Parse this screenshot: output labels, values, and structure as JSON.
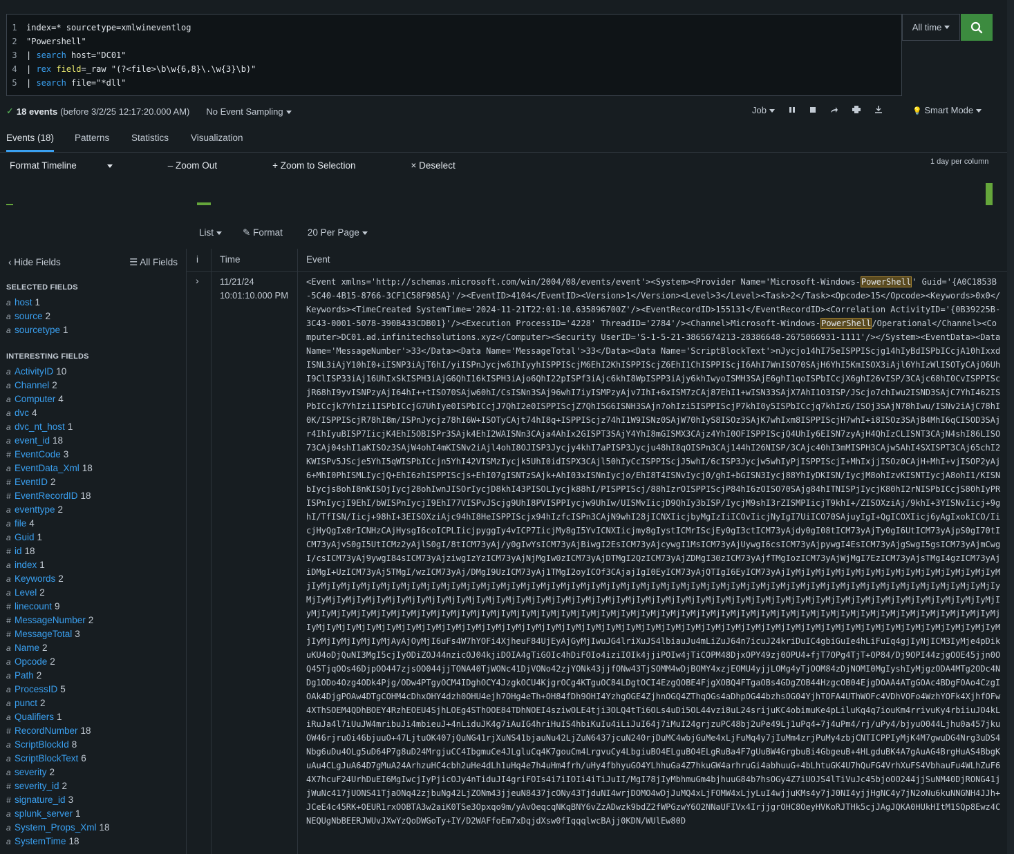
{
  "search": {
    "lines": [
      {
        "num": "1",
        "parts": [
          {
            "t": "index=* sourcetype=xmlwineventlog",
            "c": ""
          }
        ]
      },
      {
        "num": "2",
        "parts": [
          {
            "t": "\"Powershell\"",
            "c": ""
          }
        ]
      },
      {
        "num": "3",
        "parts": [
          {
            "t": "| ",
            "c": ""
          },
          {
            "t": "search",
            "c": "kw"
          },
          {
            "t": " host=\"DC01\"",
            "c": ""
          }
        ]
      },
      {
        "num": "4",
        "parts": [
          {
            "t": "| ",
            "c": ""
          },
          {
            "t": "rex",
            "c": "kw"
          },
          {
            "t": " ",
            "c": ""
          },
          {
            "t": "field",
            "c": "kw2"
          },
          {
            "t": "=_raw \"(?<file>\\b\\w{6,8}\\.\\w{3}\\b)\"",
            "c": ""
          }
        ]
      },
      {
        "num": "5",
        "parts": [
          {
            "t": "| ",
            "c": ""
          },
          {
            "t": "search",
            "c": "kw"
          },
          {
            "t": " file=\"*dll\"",
            "c": ""
          }
        ]
      }
    ],
    "time_range": "All time"
  },
  "status": {
    "events_count": "18 events",
    "before": "(before 3/2/25 12:17:20.000 AM)",
    "sampling": "No Event Sampling",
    "job": "Job",
    "mode": "Smart Mode"
  },
  "tabs": [
    {
      "label": "Events (18)"
    },
    {
      "label": "Patterns"
    },
    {
      "label": "Statistics"
    },
    {
      "label": "Visualization"
    }
  ],
  "timeline": {
    "format": "Format Timeline",
    "zoom_out": "Zoom Out",
    "zoom_sel": "Zoom to Selection",
    "deselect": "Deselect",
    "per_column": "1 day per column"
  },
  "list_opts": {
    "list": "List",
    "format": "Format",
    "per_page": "20 Per Page"
  },
  "sidebar": {
    "hide": "Hide Fields",
    "all": "All Fields",
    "selected_heading": "SELECTED FIELDS",
    "interesting_heading": "INTERESTING FIELDS",
    "selected": [
      {
        "type": "a",
        "name": "host",
        "count": "1"
      },
      {
        "type": "a",
        "name": "source",
        "count": "2"
      },
      {
        "type": "a",
        "name": "sourcetype",
        "count": "1"
      }
    ],
    "interesting": [
      {
        "type": "a",
        "name": "ActivityID",
        "count": "10"
      },
      {
        "type": "a",
        "name": "Channel",
        "count": "2"
      },
      {
        "type": "a",
        "name": "Computer",
        "count": "4"
      },
      {
        "type": "a",
        "name": "dvc",
        "count": "4"
      },
      {
        "type": "a",
        "name": "dvc_nt_host",
        "count": "1"
      },
      {
        "type": "a",
        "name": "event_id",
        "count": "18"
      },
      {
        "type": "#",
        "name": "EventCode",
        "count": "3"
      },
      {
        "type": "a",
        "name": "EventData_Xml",
        "count": "18"
      },
      {
        "type": "#",
        "name": "EventID",
        "count": "2"
      },
      {
        "type": "#",
        "name": "EventRecordID",
        "count": "18"
      },
      {
        "type": "a",
        "name": "eventtype",
        "count": "2"
      },
      {
        "type": "a",
        "name": "file",
        "count": "4"
      },
      {
        "type": "a",
        "name": "Guid",
        "count": "1"
      },
      {
        "type": "#",
        "name": "id",
        "count": "18"
      },
      {
        "type": "a",
        "name": "index",
        "count": "1"
      },
      {
        "type": "a",
        "name": "Keywords",
        "count": "2"
      },
      {
        "type": "a",
        "name": "Level",
        "count": "2"
      },
      {
        "type": "#",
        "name": "linecount",
        "count": "9"
      },
      {
        "type": "#",
        "name": "MessageNumber",
        "count": "2"
      },
      {
        "type": "#",
        "name": "MessageTotal",
        "count": "3"
      },
      {
        "type": "a",
        "name": "Name",
        "count": "2"
      },
      {
        "type": "a",
        "name": "Opcode",
        "count": "2"
      },
      {
        "type": "a",
        "name": "Path",
        "count": "2"
      },
      {
        "type": "a",
        "name": "ProcessID",
        "count": "5"
      },
      {
        "type": "a",
        "name": "punct",
        "count": "2"
      },
      {
        "type": "a",
        "name": "Qualifiers",
        "count": "1"
      },
      {
        "type": "#",
        "name": "RecordNumber",
        "count": "18"
      },
      {
        "type": "a",
        "name": "ScriptBlockId",
        "count": "8"
      },
      {
        "type": "a",
        "name": "ScriptBlockText",
        "count": "6"
      },
      {
        "type": "a",
        "name": "severity",
        "count": "2"
      },
      {
        "type": "#",
        "name": "severity_id",
        "count": "2"
      },
      {
        "type": "#",
        "name": "signature_id",
        "count": "3"
      },
      {
        "type": "a",
        "name": "splunk_server",
        "count": "1"
      },
      {
        "type": "a",
        "name": "System_Props_Xml",
        "count": "18"
      },
      {
        "type": "a",
        "name": "SystemTime",
        "count": "18"
      }
    ]
  },
  "table": {
    "col_i": "i",
    "col_time": "Time",
    "col_event": "Event",
    "event": {
      "date": "11/21/24",
      "time": "10:01:10.000 PM",
      "raw_pre1": "<Event xmlns='http://schemas.microsoft.com/win/2004/08/events/event'><System><Provider Name='Microsoft-Windows-",
      "hl1": "PowerShell",
      "raw_mid": "' Guid='{A0C1853B-5C40-4B15-8766-3CF1C58F985A}'/><EventID>4104</EventID><Version>1</Version><Level>3</Level><Task>2</Task><Opcode>15</Opcode><Keywords>0x0</Keywords><TimeCreated SystemTime='2024-11-21T22:01:10.635896700Z'/><EventRecordID>155131</EventRecordID><Correlation ActivityID='{0B39225B-3C43-0001-5078-390B433CDB01}'/><Execution ProcessID='4228' ThreadID='2784'/><Channel>Microsoft-Windows-",
      "hl2": "PowerShell",
      "raw_post": "/Operational</Channel><Computer>DC01.ad.infinitechsolutions.xyz</Computer><Security UserID='S-1-5-21-3865674213-28386648-2675066931-1111'/></System><EventData><Data Name='MessageNumber'>33</Data><Data Name='MessageTotal'>33</Data><Data Name='ScriptBlockText'>nJycjo14hI75eISPPIScjg14hIyBdISPbICcjA10hIxxdISNL3iAjY10hI0+iISNP3iAjT6hI/yiISPnJycjw6IhIyyhISPPIScjM6EhI2KhISPPIScjZ6EhI1ChISPPIScjI6AhI7WnISO70SAjH6YhI5KmISOX3iAjl6YhIzWlISOTyCAjO6UhI9ClISP33iAj16UhIxSkISPH3iAjG6QhI16kISPH3iAjo6QhI22pISPf3iAjc6khI8WpISPP3iAjy6khIwyoISMH3SAjE6ghI1qoISPbICcjX6ghI26vISP/3CAjc68hI0CvISPPIScjR68hI9yvISNPzyAjI64hI++tISO70SAjw60hI/CsISNn3SAj96whI7iyISMPzyAjv7IhI+6xISM7zCAj87EhI1+wISN33SAjX7AhI1O3ISP/JScjo7chIwu2ISND3SAjC7YhI462ISPbICcjk7YhIzi1ISPbICcjG7UhIye0ISPbICcjJ7QhI2e0ISPPIScjZ7QhI5G6ISNH3SAjn7ohIzi5ISPPIScjP7khI0y5ISPbICcjq7khIzG/ISOj3SAjN78hIwu/ISNv2iAjC78hI0K/ISPPIScjR78hI8m/ISPnJycjz78hI6W+ISOTyCAjt74hI8q+ISPPIScjz74hI1W9ISNz0SAjW70hIyS8ISOz3SAjK7whIxm8ISPPIScjH7whI+i8ISOz3SAjB4MhI6qCISOD3SAjr4IhIyuBISP7IicjK4EhI5OBISPr3SAjk4EhI2WAISNn3CAja4AhIx2GISPT3SAjY4YhI8mGISMX3CAjz4YhI0OFISPPIScjQ4UhIy6EISN7zyAjH4QhIzCLISNT3CAjN4shI86LISO73CAj04shI1aKISOz3SAjW4ohI4mKISNv2iAjl4ohI8OJISP3Jycjy4khI7aPISP3Jycju48hI8qOISPn3CAj144hI26NISP/3CAjc40hI3mMISPH3CAjw5AhI4SXISPT3CAj65chI2KWISPv5JScje5YhI5qWISPbICcjn5YhI42VISMzIycjk5UhI0idISPX3CAjl50hIyCcISPPIScjJ5whI/6cISP3Jycjw5whIyPjISPPIScjI+MhIxjjISOz0CAjH+MhI+vjISOP2yAj6+MhI0PhISMLIycjQ+EhI6zhISPPIScjs+EhI07gISNTzSAjk+AhI03xISNnIycjo/EhI8T4ISNvIycj0/ghI+bGISN3Iycj88YhIyDKISN/IycjM8ohIzvKISNTIycjA8ohI1/KISNbIycjs8ohI8nKISOjIycj28ohIwnJISOrIycjD8khI43PISOLIycjk88hI/PISPPIScj/88hIzrOISPPIScjP84hI6zOISO70SAjg84hITNISPjIycjK80hI2rNISPbICcjS80hIyPRISPnIycjI9EhI/bWISPnIycjI9EhI77VISPvJScjg9UhI8PVISPPIycjw9UhIw/UISMvIicjD9QhIy3bISP/IycjM9shI3rZISMPIicjT9khI+/ZISOXziAj/9khI+3YISNvIicj+9ghI/TfISN/Iicj+98hI+3EISOXziAjc94hI8HeISPPIScjx94hIzfcISPn3CAjN9whI28jICNXIicjbyMgIzIiICOvIicjNyIgI7UiICO70SAjuyIgI+QgICOXIicj6yAgIxokICO/IicjHyQgIx8rICNHzCAjHysgI6coICPLIicjpyggIy4vICP7IicjMy8gI5YvICNXIicjmy8gIystICMrIScjEy0gI3ctICM73yAjdy0gI08tICM73yAjTy0gI6UtICM73yAjpS0gI70tICM73yAjvS0gI5UtICMz2yAjlS0gI/8tICM73yAj/y0gIwYsICM73yAjBiwgI2EsICM73yAjcywgI1MsICM73yAjUywgI6csICM73yAjpywgI4EsICM73yAjgSwgI5gsICM73yAjmCwgI/csICM73yAj9ywgI84sICM73yAjziwgIzYzICM73yAjNjMgIw0zICM73yAjDTMgI2QzICM73yAjZDMgI30zICM73yAjfTMgIozICM73yAjWjMgI7EzICM73yAjsTMgI4gzICM73yAjiDMgI+UzICM73yAj5TMgI/wzICM73yAj/DMgI9UzICM73yAj1TMgI2oyICOf3CAjajIgI0EyICM73yAjQTIgI6EyICM73yAjIyMjIyMjIyMjIyMjIyMjIyMjIyMjIyMjIyMjIyMjIyMjIyMjIyMjIyMjIyMjIyMjIyMjIyMjIyMjIyMjIyMjIyMjIyMjIyMjIyMjIyMjIyMjIyMjIyMjIyMjIyMjIyMjIyMjIyMjIyMjIyMjIyMjIyMjIyMjIyMjIyMjIyMjIyMjIyMjIyMjIyMjIyMjIyMjIyMjIyMjIyMjIyMjIyMjIyMjIyMjIyMjIyMjIyMjIyMjIyMjIyMjIyMjIyMjIyMjIyMjIyMjIyMjIyMjIyMjIyMjIyMjIyMjIyMjIyMjIyMjIyMjIyMjIyMjIyMjIyMjIyMjIyMjIyMjIyMjIyMjIyMjIyMjIyMjIyMjIyMjIyMjIyMjIyMjIyMjIyMjIyMjIyMjIyMjIyMjIyMjIyMjIyMjIyMjIyMjIyMjIyMjIyMjIyMjIyMjIyMjIyMjIyMjIyMjIyMjIyMjIyMjIyMjIyMjIyMjIyMjIyMjIyMjIyMjIyMjIyMjIyMjIyMjIyMjIyMjIyMjIyMjIyMjIyMjIyMjIyMjIyMjIyMjIyMjIyMjIyMjIyMjIyMjIyMjIyMjIyMjIyMjIyMjIyMjIyMjIyMjIyMjIyMjIyMjIyMjAyAjOyMjI6uFs4W7hYOFi4XjheuF84UjEyAjGyMjIwuJG4lriXuJS4lbiauJu4mLiZuJ64n7icuJ24kriDuIC4gbiGuIe4hLiFuIq4gjIyNjICM3IyMje4pDikuKU4oDjQuNI3MgI5cjIyODiZOJ44nzicOJ04kjiDOIA4gTiGOIc4hDiFOIo4iziIOIk4jjiPOIw4jTiCOPM48DjxOPY49zj0OPU4+fjT7OPg4TjT+OP84/Dj9OPI44zjgOOE45jjn0OQ45TjqOOs46DjpOO447zjsOO044jjTONA40TjWONc41DjVONo42zjYONk43jjfONw43TjSOMM4wDjBOMY4xzjEOMU4yjjLOMg4yTjOOM84zDjNOMI0MgIyshIyMjgzODA4MTg2ODc4NDg1ODo4Ozg4ODk4Pjg/ODw4PTgyOCM4IDghOCY4JzgkOCU4KjgrOCg4KTguOC84LDgtOCI4EzgQOBE4FjgXOBQ4FTgaOBs4GDgZOB44HzgcOB04EjgDOAA4ATgGOAc4BDgFOAo4CzgIOAk4DjgPOAw4DTgCOHM4cDhxOHY4dzh0OHU4ejh7OHg4eTh+OH84fDh9OHI4YzhgOGE4ZjhnOGQ4ZThqOGs4aDhpOG44bzhsOG04YjhTOFA4UThWOFc4VDhVOFo4WzhYOFk4XjhfOFw4XThSOEM4QDhBOEY4RzhEOEU4SjhLOEg4SThOOE84TDhNOEI4sziwOLE4tji3OLQ4tTi6OLs4uDi5OL44vzi8uL24srijuKC4obimuKe4pLiluKq4q7iouKm4rrivuKy4rbiiuJO4kLiRuJa4l7iUuJW4mribuJi4mbieuJ+4nLiduJK4g7iAuIG4hriHuIS4hbiKuIu4iLiJuI64j7iMuI24grjzuPC48bj2uPe49Lj1uPq4+7j4uPm4/rj/uPy4/bjyuO044Ljhu0a457jkuOW46rjruOi46bjuuO+47LjtuOK407jQuNG41rjXuNS41bjauNu42LjZuN6437jcuN240rjDuMC4wbjGuMe4xLjFuMq4y7jIuMm4zrjPuMy4zbjCNTICPPIyMjK4M7gwuDG4Nrg3uDS4Nbg6uDu4OLg5uD64P7g8uD24MrgjuCC4IbgmuCe4JLgluCq4K7gouCm4LrgvuCy4LbgiuBO4ELguBO4ELgRuBa4F7gUuBW4GrgbuBi4GbgeuB+4HLgduBK4A7gAuAG4BrgHuAS4BbgKuAu4CLgJuA64D7gMuA24ArhzuHC4cbh2uHe4dLh1uHq4e7h4uHm4frh/uHy4fbhyuGO4YLhhuGa4Z7hkuGW4arhruGi4abhuuG+4bLhtuGK4U7hQuFG4VrhXuFS4VbhauFu4WLhZuF64X7hcuF24UrhDuEI6MgIwcjIyPjicOJy4nTiduJI4griFOIs4i7iIOIi4iTiJuII/MgI78jIyMbhmuGm4bjhuuG84b7hsOGy4Z7iUOJS4lTiVuJc45bjoOO244jjSuNM40DjRONG41jjWuNc417jUONS41TjaONq42zjbuNg42LjZONm43jjeuN8437jcONy43TjduNI4wrjDOMO4wDjJuMQ4xLjFOMW4xLjyLuI4wjjuKMs4y7jJ0NI4yjjHgNC4y7jN2oNu6kuNNGNH4JJh+JCeE4c45RK+OEUR1rxOOBTA3w2aiK0TSe3Opxqo9m/yAvOeqcqNKqBNY6vZzADwzk9bdZ2fWPGzwY6O2NNaUFIVx4IrjjgrOHC8OeyHVKoRJTHk5cjJAgJQKA0HUkHItM1SQp8Ewz4CNEQUgNbBEERJWUvJXwYzQoDWGoTy+IY/D2WAFfoEm7xDqjdXsw0fIqqqlwcBAjj0KDN/WUlEw80D"
    }
  }
}
